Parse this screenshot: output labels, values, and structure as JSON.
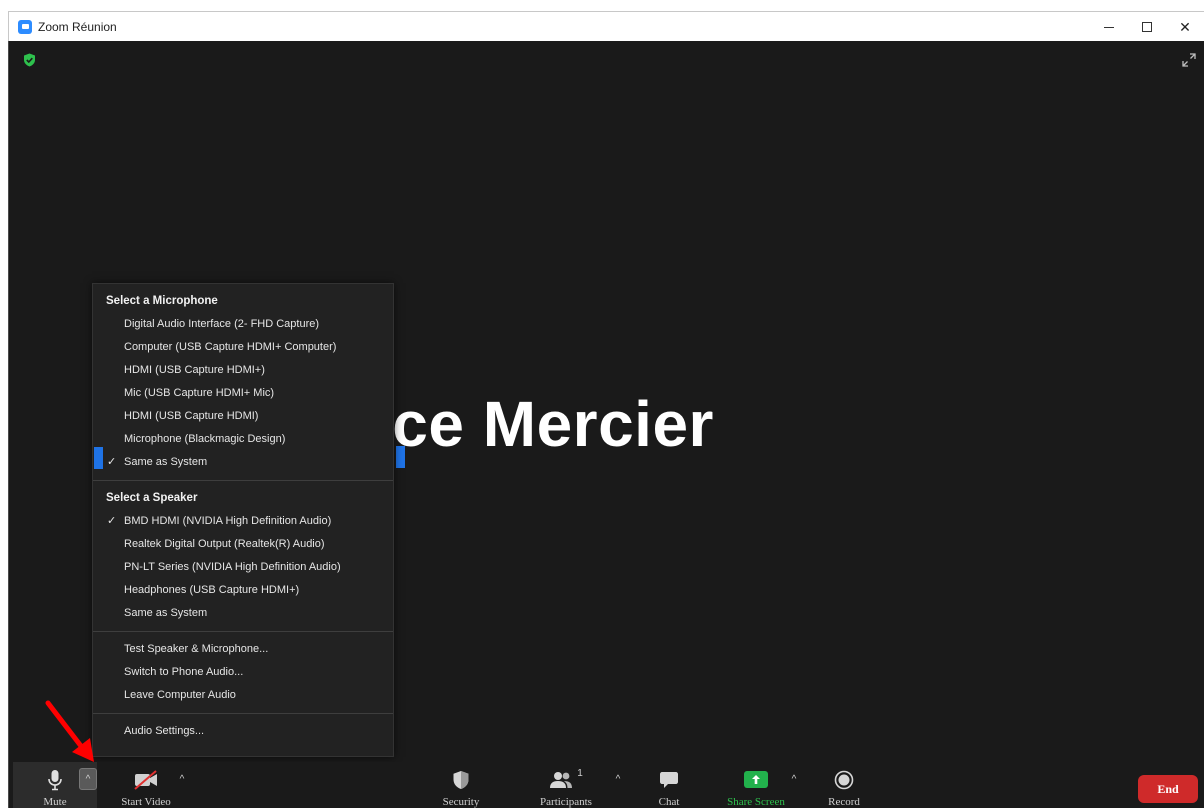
{
  "window": {
    "title": "Zoom Réunion",
    "close_glyph": "✕"
  },
  "stage": {
    "participant_name": "brice Mercier"
  },
  "audio_menu": {
    "microphone_header": "Select a Microphone",
    "microphones": [
      {
        "label": "Digital Audio Interface (2- FHD Capture)",
        "checked": false
      },
      {
        "label": "Computer (USB Capture HDMI+ Computer)",
        "checked": false
      },
      {
        "label": "HDMI (USB Capture HDMI+)",
        "checked": false
      },
      {
        "label": "Mic (USB Capture HDMI+ Mic)",
        "checked": false
      },
      {
        "label": "HDMI (USB Capture HDMI)",
        "checked": false
      },
      {
        "label": "Microphone (Blackmagic Design)",
        "checked": false
      },
      {
        "label": "Same as System",
        "checked": true
      }
    ],
    "speaker_header": "Select a Speaker",
    "speakers": [
      {
        "label": "BMD HDMI (NVIDIA High Definition Audio)",
        "checked": true
      },
      {
        "label": "Realtek Digital Output (Realtek(R) Audio)",
        "checked": false
      },
      {
        "label": "PN-LT Series (NVIDIA High Definition Audio)",
        "checked": false
      },
      {
        "label": "Headphones (USB Capture HDMI+)",
        "checked": false
      },
      {
        "label": "Same as System",
        "checked": false
      }
    ],
    "check_glyph": "✓",
    "actions": [
      "Test Speaker & Microphone...",
      "Switch to Phone Audio...",
      "Leave Computer Audio"
    ],
    "settings": "Audio Settings..."
  },
  "toolbar": {
    "mute_label": "Mute",
    "start_video_label": "Start Video",
    "security_label": "Security",
    "participants_label": "Participants",
    "participants_count": "1",
    "chat_label": "Chat",
    "share_screen_label": "Share Screen",
    "record_label": "Record",
    "end_label": "End",
    "caret_glyph": "^"
  },
  "colors": {
    "accent_blue": "#1f73e6",
    "share_green": "#22b14c",
    "end_red": "#cf2a2a",
    "shield_green": "#2ec14d",
    "annotation_red": "#ff0000"
  },
  "icons": {
    "app": "zoom-app-icon",
    "encryption": "shield-check-icon",
    "fullscreen": "expand-icon",
    "microphone": "microphone-icon",
    "video": "video-off-icon",
    "security": "shield-icon",
    "participants": "people-icon",
    "chat": "chat-bubble-icon",
    "share": "share-screen-icon",
    "record": "record-icon",
    "annotation": "red-arrow-icon"
  }
}
